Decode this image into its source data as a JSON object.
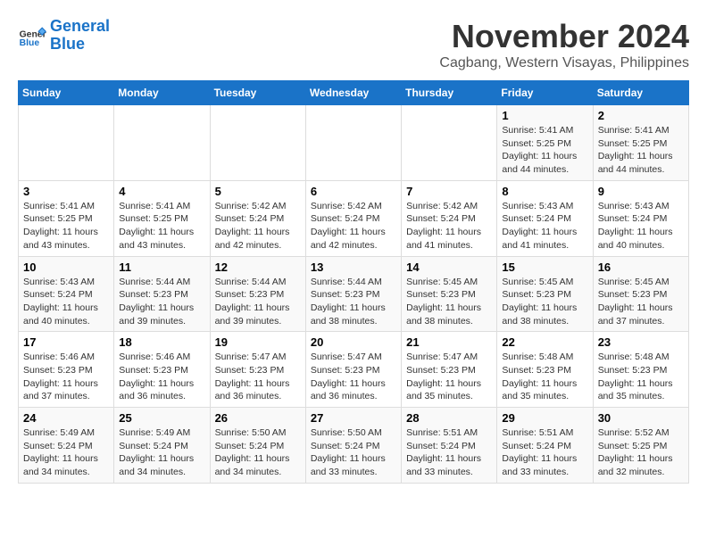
{
  "header": {
    "logo_line1": "General",
    "logo_line2": "Blue",
    "month_year": "November 2024",
    "location": "Cagbang, Western Visayas, Philippines"
  },
  "days_of_week": [
    "Sunday",
    "Monday",
    "Tuesday",
    "Wednesday",
    "Thursday",
    "Friday",
    "Saturday"
  ],
  "weeks": [
    [
      {
        "day": "",
        "info": ""
      },
      {
        "day": "",
        "info": ""
      },
      {
        "day": "",
        "info": ""
      },
      {
        "day": "",
        "info": ""
      },
      {
        "day": "",
        "info": ""
      },
      {
        "day": "1",
        "info": "Sunrise: 5:41 AM\nSunset: 5:25 PM\nDaylight: 11 hours and 44 minutes."
      },
      {
        "day": "2",
        "info": "Sunrise: 5:41 AM\nSunset: 5:25 PM\nDaylight: 11 hours and 44 minutes."
      }
    ],
    [
      {
        "day": "3",
        "info": "Sunrise: 5:41 AM\nSunset: 5:25 PM\nDaylight: 11 hours and 43 minutes."
      },
      {
        "day": "4",
        "info": "Sunrise: 5:41 AM\nSunset: 5:25 PM\nDaylight: 11 hours and 43 minutes."
      },
      {
        "day": "5",
        "info": "Sunrise: 5:42 AM\nSunset: 5:24 PM\nDaylight: 11 hours and 42 minutes."
      },
      {
        "day": "6",
        "info": "Sunrise: 5:42 AM\nSunset: 5:24 PM\nDaylight: 11 hours and 42 minutes."
      },
      {
        "day": "7",
        "info": "Sunrise: 5:42 AM\nSunset: 5:24 PM\nDaylight: 11 hours and 41 minutes."
      },
      {
        "day": "8",
        "info": "Sunrise: 5:43 AM\nSunset: 5:24 PM\nDaylight: 11 hours and 41 minutes."
      },
      {
        "day": "9",
        "info": "Sunrise: 5:43 AM\nSunset: 5:24 PM\nDaylight: 11 hours and 40 minutes."
      }
    ],
    [
      {
        "day": "10",
        "info": "Sunrise: 5:43 AM\nSunset: 5:24 PM\nDaylight: 11 hours and 40 minutes."
      },
      {
        "day": "11",
        "info": "Sunrise: 5:44 AM\nSunset: 5:23 PM\nDaylight: 11 hours and 39 minutes."
      },
      {
        "day": "12",
        "info": "Sunrise: 5:44 AM\nSunset: 5:23 PM\nDaylight: 11 hours and 39 minutes."
      },
      {
        "day": "13",
        "info": "Sunrise: 5:44 AM\nSunset: 5:23 PM\nDaylight: 11 hours and 38 minutes."
      },
      {
        "day": "14",
        "info": "Sunrise: 5:45 AM\nSunset: 5:23 PM\nDaylight: 11 hours and 38 minutes."
      },
      {
        "day": "15",
        "info": "Sunrise: 5:45 AM\nSunset: 5:23 PM\nDaylight: 11 hours and 38 minutes."
      },
      {
        "day": "16",
        "info": "Sunrise: 5:45 AM\nSunset: 5:23 PM\nDaylight: 11 hours and 37 minutes."
      }
    ],
    [
      {
        "day": "17",
        "info": "Sunrise: 5:46 AM\nSunset: 5:23 PM\nDaylight: 11 hours and 37 minutes."
      },
      {
        "day": "18",
        "info": "Sunrise: 5:46 AM\nSunset: 5:23 PM\nDaylight: 11 hours and 36 minutes."
      },
      {
        "day": "19",
        "info": "Sunrise: 5:47 AM\nSunset: 5:23 PM\nDaylight: 11 hours and 36 minutes."
      },
      {
        "day": "20",
        "info": "Sunrise: 5:47 AM\nSunset: 5:23 PM\nDaylight: 11 hours and 36 minutes."
      },
      {
        "day": "21",
        "info": "Sunrise: 5:47 AM\nSunset: 5:23 PM\nDaylight: 11 hours and 35 minutes."
      },
      {
        "day": "22",
        "info": "Sunrise: 5:48 AM\nSunset: 5:23 PM\nDaylight: 11 hours and 35 minutes."
      },
      {
        "day": "23",
        "info": "Sunrise: 5:48 AM\nSunset: 5:23 PM\nDaylight: 11 hours and 35 minutes."
      }
    ],
    [
      {
        "day": "24",
        "info": "Sunrise: 5:49 AM\nSunset: 5:24 PM\nDaylight: 11 hours and 34 minutes."
      },
      {
        "day": "25",
        "info": "Sunrise: 5:49 AM\nSunset: 5:24 PM\nDaylight: 11 hours and 34 minutes."
      },
      {
        "day": "26",
        "info": "Sunrise: 5:50 AM\nSunset: 5:24 PM\nDaylight: 11 hours and 34 minutes."
      },
      {
        "day": "27",
        "info": "Sunrise: 5:50 AM\nSunset: 5:24 PM\nDaylight: 11 hours and 33 minutes."
      },
      {
        "day": "28",
        "info": "Sunrise: 5:51 AM\nSunset: 5:24 PM\nDaylight: 11 hours and 33 minutes."
      },
      {
        "day": "29",
        "info": "Sunrise: 5:51 AM\nSunset: 5:24 PM\nDaylight: 11 hours and 33 minutes."
      },
      {
        "day": "30",
        "info": "Sunrise: 5:52 AM\nSunset: 5:25 PM\nDaylight: 11 hours and 32 minutes."
      }
    ]
  ]
}
